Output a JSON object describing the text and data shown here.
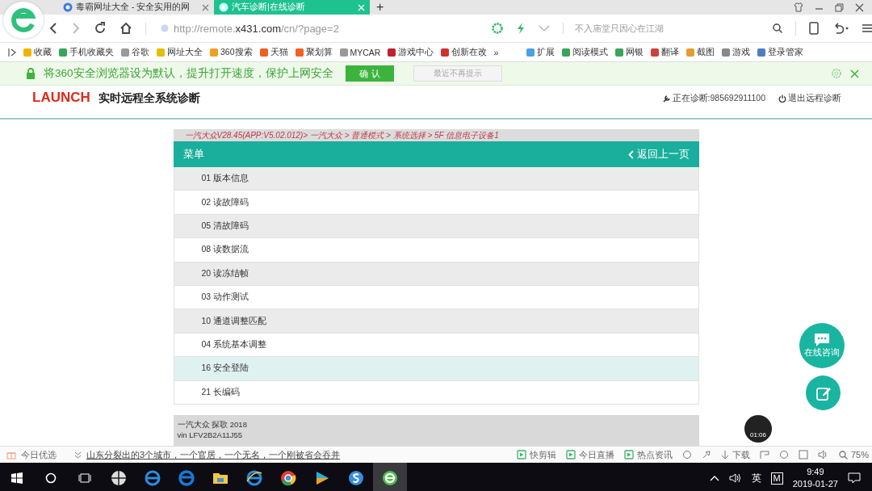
{
  "browser": {
    "tabs": [
      {
        "title": "毒霸网址大全 - 安全实用的网",
        "selected": false
      },
      {
        "title": "汽车诊断|在线诊断",
        "selected": true
      }
    ],
    "new_tab": "+",
    "url": "http://remote.**x431.com**/cn/?page=2",
    "search_placeholder": "不入庙堂只因心在江湖",
    "bookmarks": [
      {
        "label": "收藏",
        "color": "#f0b400"
      },
      {
        "label": "手机收藏夹",
        "color": "#3aa55a"
      },
      {
        "label": "谷歌",
        "color": "#999999"
      },
      {
        "label": "网址大全",
        "color": "#e0c000"
      },
      {
        "label": "360搜索",
        "color": "#f0a020"
      },
      {
        "label": "天猫",
        "color": "#f06020"
      },
      {
        "label": "聚划算",
        "color": "#f06020"
      },
      {
        "label": "MYCAR",
        "color": "#999999"
      },
      {
        "label": "游戏中心",
        "color": "#c02030"
      },
      {
        "label": "创新在改",
        "color": "#d03030"
      }
    ],
    "more": "»",
    "extensions": [
      {
        "label": "扩展",
        "color": "#4aa0e0"
      },
      {
        "label": "阅读模式",
        "color": "#3aa55a"
      },
      {
        "label": "网银",
        "color": "#3aa55a"
      },
      {
        "label": "翻译",
        "color": "#d04040"
      },
      {
        "label": "截图",
        "color": "#e0a030"
      },
      {
        "label": "游戏",
        "color": "#888888"
      },
      {
        "label": "登录管家",
        "color": "#4a80c0"
      }
    ]
  },
  "notice": {
    "text": "将360安全浏览器设为默认，提升打开速度，保护上网安全",
    "confirm": "确 认",
    "dismiss": "最近不再提示"
  },
  "page": {
    "brand": "LAUNCH",
    "title": "实时远程全系统诊断",
    "diagnosing": "正在诊断:985692911100",
    "exit": "退出远程诊断",
    "breadcrumb": "一汽大众V28.45(APP:V5.02.012)> 一汽大众 > 普通模式 > 系统选择 > 5F 信息电子设备1",
    "menu_title": "菜单",
    "back": "返回上一页",
    "items": [
      {
        "label": "01 版本信息",
        "selected": false
      },
      {
        "label": "02 读故障码",
        "selected": false
      },
      {
        "label": "05 清故障码",
        "selected": false
      },
      {
        "label": "08 读数据流",
        "selected": false
      },
      {
        "label": "20 读冻结帧",
        "selected": false
      },
      {
        "label": "03 动作测试",
        "selected": false
      },
      {
        "label": "10 通道调整匹配",
        "selected": false
      },
      {
        "label": "04 系统基本调整",
        "selected": false
      },
      {
        "label": "16 安全登陆",
        "selected": true
      },
      {
        "label": "21 长编码",
        "selected": false
      }
    ],
    "vehicle": "一汽大众 探歌 2018",
    "vin": "vin LFV2B2A11J55",
    "chat_label": "在线咨询",
    "timer": "01:06"
  },
  "status_bar": {
    "news_label": "今日优选",
    "headline": "山东分裂出的3个城市，一个官居，一个无名，一个刚被省会吞并",
    "tools": [
      "快剪辑",
      "今日直播",
      "热点资讯"
    ],
    "download": "下载",
    "zoom": "75%"
  },
  "taskbar": {
    "ime": "英",
    "ime_mode": "M",
    "time": "9:49",
    "date": "2019-01-27"
  }
}
